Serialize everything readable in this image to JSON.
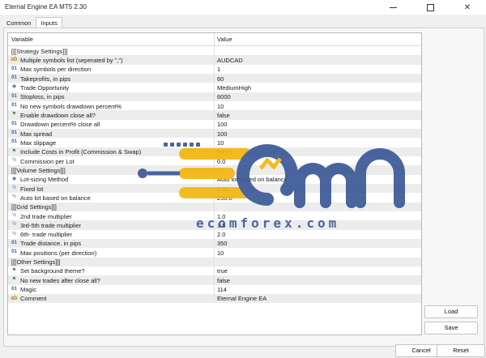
{
  "window": {
    "title": "Eternal Engine EA MT5 2.30"
  },
  "tabs": [
    {
      "label": "Common"
    },
    {
      "label": "Inputs"
    }
  ],
  "grid": {
    "columns": [
      "Variable",
      "Value"
    ],
    "rows": [
      {
        "icon": "",
        "name": "[[[Strategy Settings]]]",
        "value": ""
      },
      {
        "icon": "ab",
        "name": "Multiple symbols list (seperated by \",\")",
        "value": "AUDCAD"
      },
      {
        "icon": "01",
        "name": "Max symbols per direction",
        "value": "1"
      },
      {
        "icon": "01",
        "name": "Takeprofits, in pips",
        "value": "60"
      },
      {
        "icon": "enum",
        "name": "Trade Opportunity",
        "value": "MediumHigh"
      },
      {
        "icon": "01",
        "name": "Stoploss, in pips",
        "value": "6000"
      },
      {
        "icon": "01",
        "name": "No new symbols drawdown percent%",
        "value": "10"
      },
      {
        "icon": "bool",
        "name": "Enable drawdown close all?",
        "value": "false"
      },
      {
        "icon": "01",
        "name": "Drawdown percent% close all",
        "value": "100"
      },
      {
        "icon": "01",
        "name": "Max spread",
        "value": "100"
      },
      {
        "icon": "01",
        "name": "Max slippage",
        "value": "10"
      },
      {
        "icon": "bool",
        "name": "Include Costs in Profit (Commission & Swap)",
        "value": "false"
      },
      {
        "icon": "½",
        "name": "Commission per Lot",
        "value": "0.0"
      },
      {
        "icon": "",
        "name": "[[[Volume Settings]]]",
        "value": ""
      },
      {
        "icon": "enum",
        "name": "Lot-sizing Method",
        "value": "Auto lot based on balance"
      },
      {
        "icon": "½",
        "name": "Fixed lot",
        "value": "0.01"
      },
      {
        "icon": "½",
        "name": "Auto lot based on balance",
        "value": "250.0"
      },
      {
        "icon": "",
        "name": "[[[Grid Settings]]]",
        "value": ""
      },
      {
        "icon": "½",
        "name": "2nd trade multiplier",
        "value": "1.0"
      },
      {
        "icon": "½",
        "name": "3rd-5th trade multiplier",
        "value": "1.5"
      },
      {
        "icon": "½",
        "name": "6th- trade multiplier",
        "value": "2.0"
      },
      {
        "icon": "01",
        "name": "Trade distance, in pips",
        "value": "350"
      },
      {
        "icon": "01",
        "name": "Max positions (per direction)",
        "value": "10"
      },
      {
        "icon": "",
        "name": "[[[Other Settings]]]",
        "value": ""
      },
      {
        "icon": "bool",
        "name": "Set background theme?",
        "value": "true"
      },
      {
        "icon": "bool",
        "name": "No new trades after close all?",
        "value": "false"
      },
      {
        "icon": "01",
        "name": "Magic",
        "value": "114"
      },
      {
        "icon": "ab",
        "name": "Comment",
        "value": "Eternal Engine EA"
      }
    ]
  },
  "buttons": {
    "load": "Load",
    "save": "Save",
    "cancel": "Cancel",
    "reset": "Reset"
  },
  "watermark": {
    "text": "ecomforex.com"
  },
  "colors": {
    "watermark_blue": "#3d5a98",
    "watermark_yellow": "#f2b70f"
  }
}
